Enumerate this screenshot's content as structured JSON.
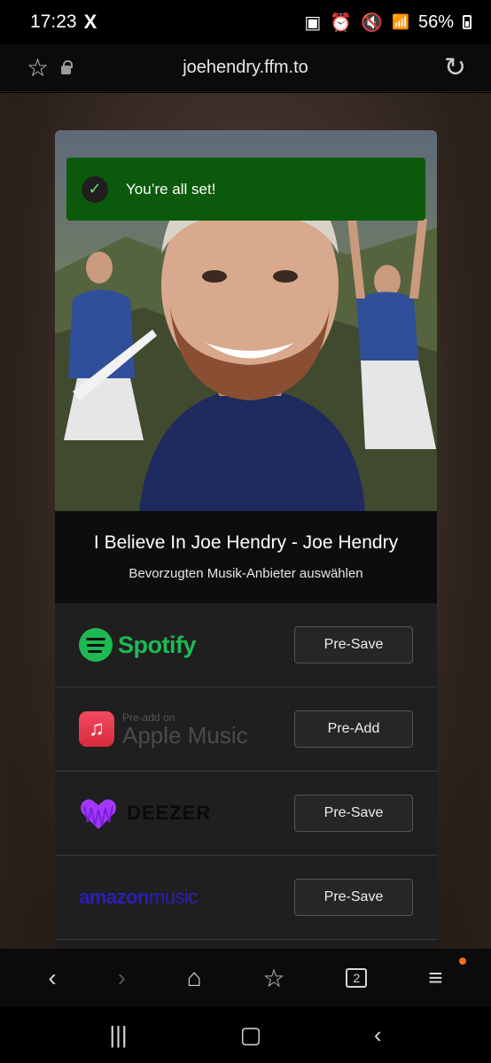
{
  "status_bar": {
    "time": "17:23",
    "x_icon": "X",
    "battery": "56%"
  },
  "address_bar": {
    "url": "joehendry.ffm.to"
  },
  "toast": {
    "message": "You’re all set!"
  },
  "release": {
    "title": "I Believe In Joe Hendry - Joe Hendry",
    "subtitle": "Bevorzugten Musik-Anbieter auswählen"
  },
  "services": [
    {
      "name": "Spotify",
      "logo_text": "Spotify",
      "button": "Pre-Save"
    },
    {
      "name": "Apple Music",
      "logo_small": "Pre-add on",
      "logo_text": "Apple Music",
      "button": "Pre-Add"
    },
    {
      "name": "Deezer",
      "logo_text": "DEEZER",
      "button": "Pre-Save"
    },
    {
      "name": "Amazon Music",
      "logo_text_bold": "amazon",
      "logo_text": "music",
      "button": "Pre-Save"
    }
  ],
  "browser_nav": {
    "tab_count": "2"
  },
  "colors": {
    "toast_bg": "#0b5a0b",
    "spotify": "#1db954",
    "apple": "#f24a5e",
    "deezer": "#a238ff",
    "amazon": "#2b1fb5"
  }
}
